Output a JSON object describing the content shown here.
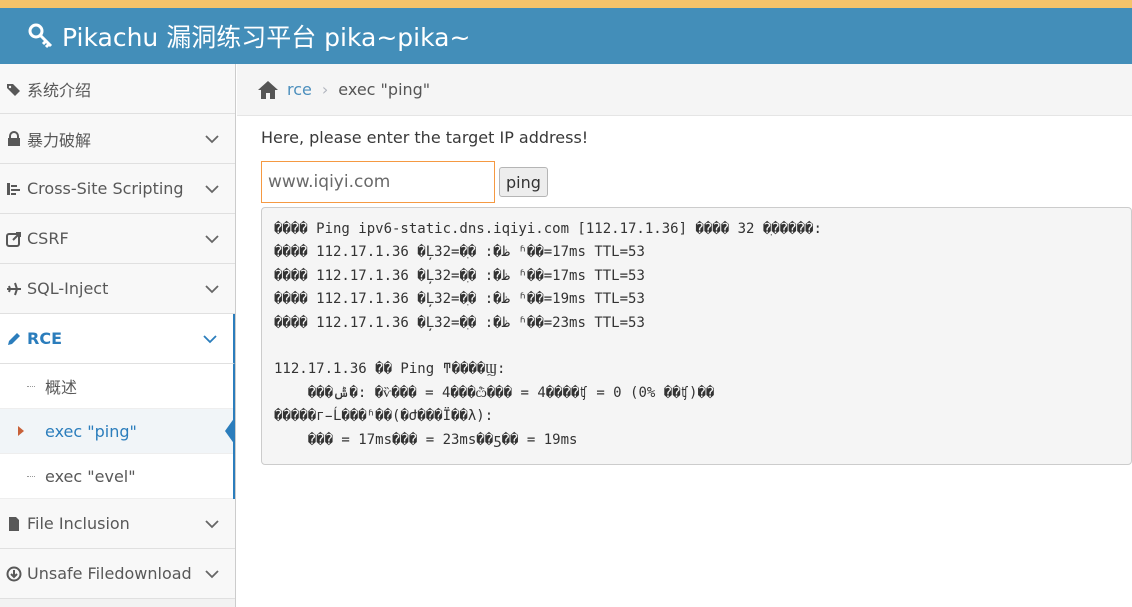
{
  "header": {
    "brand": "Pikachu 漏洞练习平台 pika~pika~",
    "icon": "key-icon",
    "accent": "#438eb9",
    "stripe": "#f5c36a"
  },
  "sidebar": {
    "items": [
      {
        "label": "系统介绍",
        "icon": "tags-icon"
      },
      {
        "label": "暴力破解",
        "icon": "lock-icon"
      },
      {
        "label": "Cross-Site Scripting",
        "icon": "sitemap-icon"
      },
      {
        "label": "CSRF",
        "icon": "share-icon"
      },
      {
        "label": "SQL-Inject",
        "icon": "plane-icon"
      },
      {
        "label": "RCE",
        "icon": "pencil-icon"
      },
      {
        "label": "File Inclusion",
        "icon": "file-icon"
      },
      {
        "label": "Unsafe Filedownload",
        "icon": "download-icon"
      }
    ],
    "rce_sub": [
      {
        "label": "概述"
      },
      {
        "label": "exec \"ping\""
      },
      {
        "label": "exec \"evel\""
      }
    ]
  },
  "breadcrumb": {
    "home_icon": "home-icon",
    "link": "rce",
    "current": "exec \"ping\""
  },
  "main": {
    "prompt": "Here, please enter the target IP address!",
    "input_value": "www.iqiyi.com",
    "button": "ping",
    "output_lines": [
      "���� Ping ipv6-static.dns.iqiyi.com [112.17.1.36] ���� 32 �ֽ�����:",
      "���� 112.17.1.36 �Ļظ�: �ֽ�=32 ʱ��=17ms TTL=53",
      "���� 112.17.1.36 �Ļظ�: �ֽ�=32 ʱ��=17ms TTL=53",
      "���� 112.17.1.36 �Ļظ�: �ֽ�=32 ʱ��=19ms TTL=53",
      "���� 112.17.1.36 �Ļظ�: �ֽ�=32 ʱ��=23ms TTL=53",
      "",
      "112.17.1.36 �� Ping ͳ����Ϣ:",
      "    ���ݰ�: �ѷ��� = 4���ѽ��� = 4����ʧ = 0 (0% ��ʧ)��",
      "�����г̵Ĺ���ʱ��(�Ժ���Ϊ��λ):",
      "    ��� = 17ms��� = 23ms��ƽ�� = 19ms"
    ]
  }
}
